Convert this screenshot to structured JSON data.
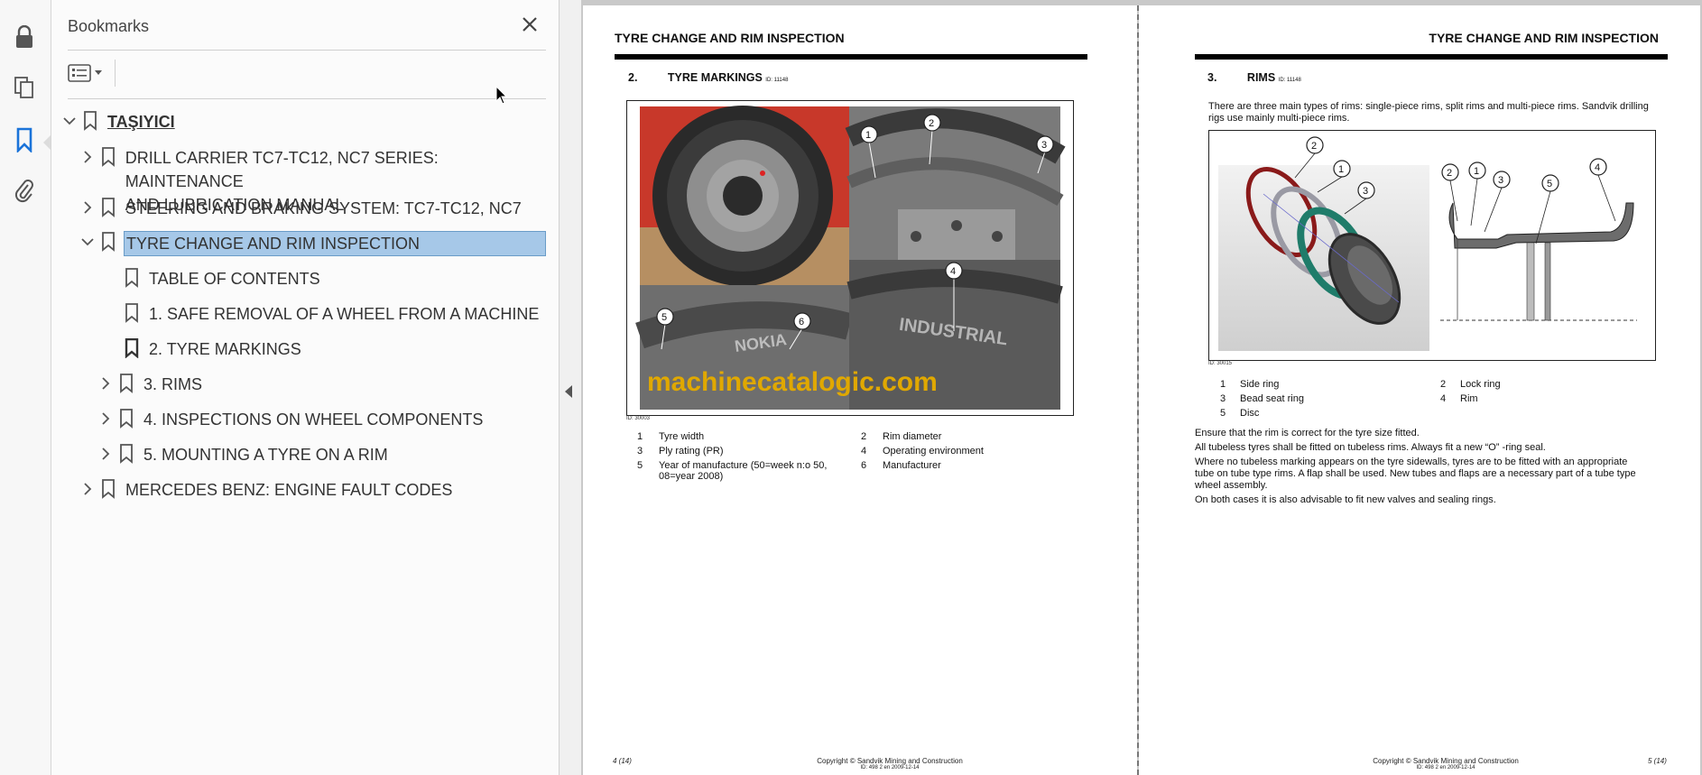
{
  "sidebar": {
    "title": "Bookmarks",
    "close_label": "✕",
    "items": [
      {
        "label": "TAŞIYICI"
      },
      {
        "label": "DRILL CARRIER TC7-TC12, NC7 SERIES: MAINTENANCE"
      },
      {
        "label": "AND LUBRICATION MANUAL"
      },
      {
        "label": "STEERING AND BRAKING SYSTEM: TC7-TC12, NC7"
      },
      {
        "label": "TYRE CHANGE AND RIM INSPECTION"
      },
      {
        "label": "TABLE OF CONTENTS"
      },
      {
        "label": "1. SAFE REMOVAL OF A WHEEL FROM A MACHINE"
      },
      {
        "label": "2. TYRE MARKINGS"
      },
      {
        "label": "3. RIMS"
      },
      {
        "label": "4. INSPECTIONS ON WHEEL COMPONENTS"
      },
      {
        "label": "5. MOUNTING A TYRE ON A RIM"
      },
      {
        "label": "MERCEDES BENZ: ENGINE FAULT CODES"
      }
    ]
  },
  "page_left": {
    "header": "TYRE CHANGE AND RIM INSPECTION",
    "section_num": "2.",
    "section_title": "TYRE MARKINGS",
    "section_id": "ID: 11148",
    "image_id": "ID: 30003",
    "watermark": "machinecatalogic.com",
    "callouts": [
      "1",
      "2",
      "3",
      "4",
      "5",
      "6"
    ],
    "tire_text": [
      "INDUSTRIAL",
      "NOKIA"
    ],
    "legend": [
      {
        "n": "1",
        "t": "Tyre width",
        "n2": "2",
        "t2": "Rim diameter"
      },
      {
        "n": "3",
        "t": "Ply rating (PR)",
        "n2": "4",
        "t2": "Operating environment"
      },
      {
        "n": "5",
        "t": "Year of manufacture (50=week n:o 50,",
        "n2": "6",
        "t2": "Manufacturer"
      }
    ],
    "legend_cont": "08=year 2008)",
    "footer_page": "4 (14)",
    "footer_copy": "Copyright © Sandvik Mining and Construction",
    "footer_id": "ID: 498 2 en 2009-12-14"
  },
  "page_right": {
    "header": "TYRE CHANGE AND RIM INSPECTION",
    "section_num": "3.",
    "section_title": "RIMS",
    "section_id": "ID: 11148",
    "intro_1": "There are three main types of rims: single-piece rims, split rims and multi-piece rims. Sandvik drilling",
    "intro_2": "rigs use mainly multi-piece rims.",
    "image_id": "ID: 30015",
    "callouts": [
      "1",
      "2",
      "3",
      "4",
      "5"
    ],
    "legend": [
      {
        "n": "1",
        "t": "Side ring",
        "n2": "2",
        "t2": "Lock ring"
      },
      {
        "n": "3",
        "t": "Bead seat ring",
        "n2": "4",
        "t2": "Rim"
      },
      {
        "n": "5",
        "t": "Disc",
        "n2": "",
        "t2": ""
      }
    ],
    "p1": "Ensure that the rim is correct for the tyre size fitted.",
    "p2": "All tubeless tyres shall be fitted on tubeless rims. Always fit a new “O” -ring seal.",
    "p3a": "Where no tubeless marking appears on the tyre sidewalls, tyres are to be fitted with an appropriate",
    "p3b": "tube on tube type rims. A flap shall be used. New tubes and flaps are a necessary part of a tube type",
    "p3c": "wheel assembly.",
    "p4": "On both cases it is also advisable to fit new valves and sealing rings.",
    "footer_page": "5 (14)",
    "footer_copy": "Copyright © Sandvik Mining and Construction",
    "footer_id": "ID: 498 2 en 2009-12-14"
  }
}
